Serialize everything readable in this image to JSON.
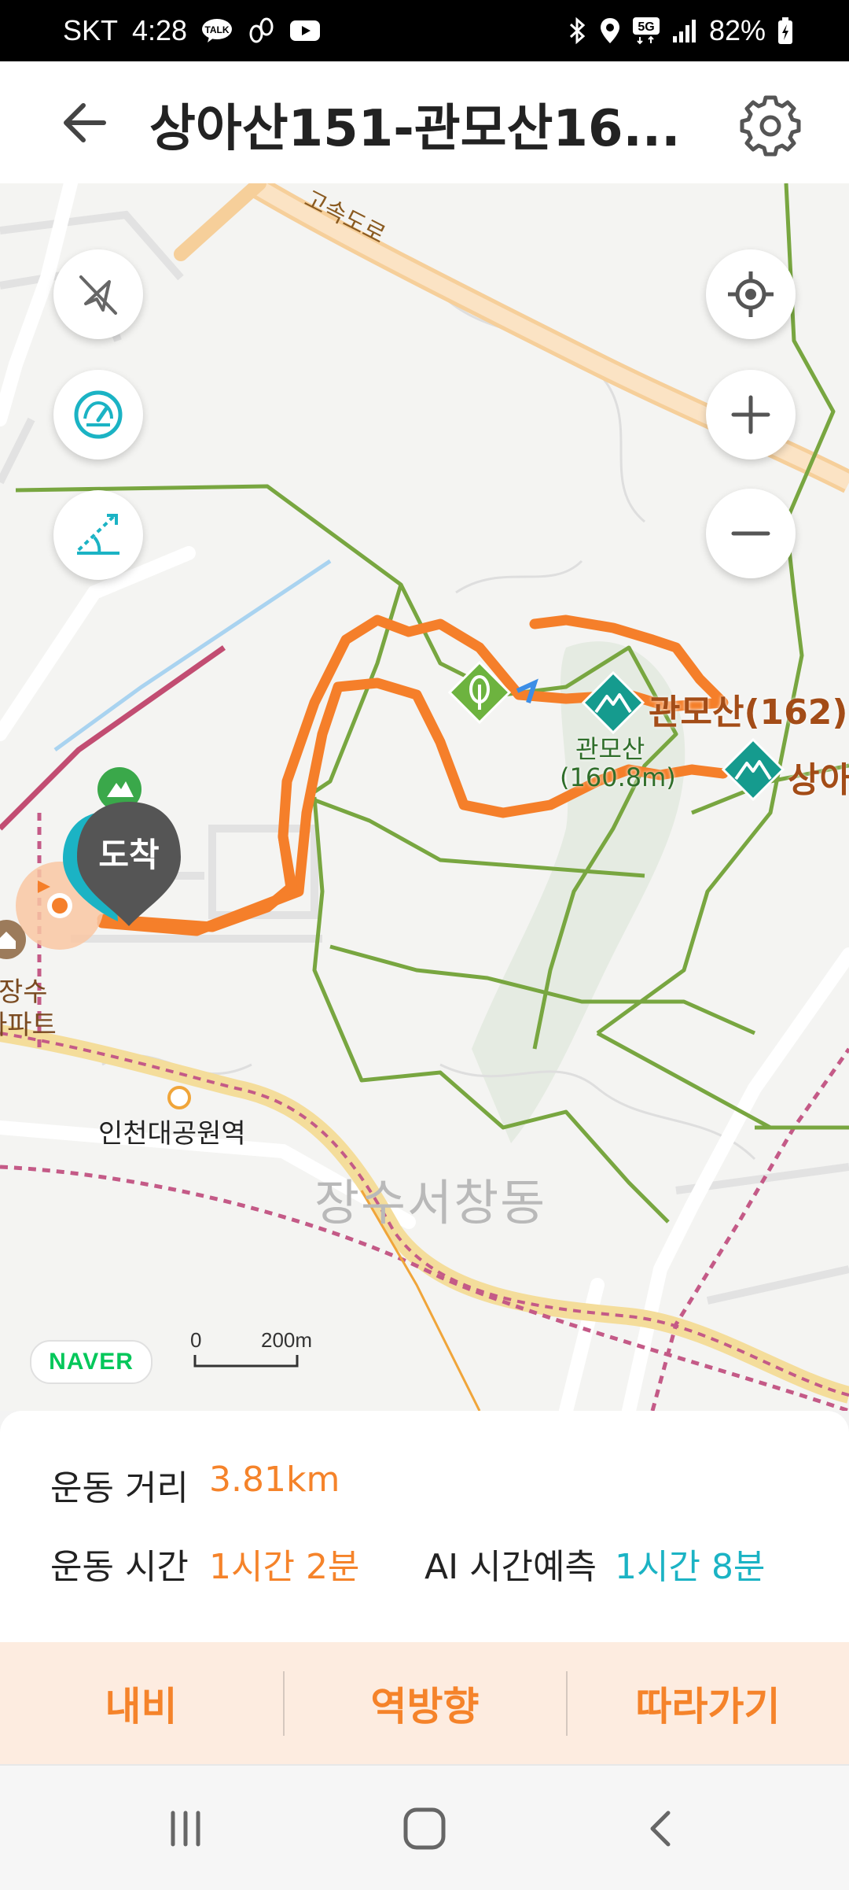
{
  "status_bar": {
    "carrier": "SKT",
    "time": "4:28",
    "talk_badge": "TALK",
    "network": "5G",
    "battery": "82%"
  },
  "header": {
    "title": "상아산151-관모산16..."
  },
  "map": {
    "labels": {
      "highway": "고속도로",
      "peak_main": "관모산(162)",
      "peak_sub_name": "관모산",
      "peak_sub_height": "(160.8m)",
      "peak_right": "상아",
      "arrival_marker": "도착",
      "apartment_line1": "장수",
      "apartment_line2": "아파트",
      "station": "인천대공원역",
      "district": "장수서창동"
    },
    "attribution": "NAVER",
    "scale": {
      "zero": "0",
      "distance": "200m"
    },
    "colors": {
      "route": "#f57f2a",
      "trail": "#78a640",
      "peak": "#159b8e"
    }
  },
  "info": {
    "distance_label": "운동 거리",
    "distance_value": "3.81km",
    "time_label": "운동 시간",
    "time_value": "1시간 2분",
    "ai_label": "AI 시간예측",
    "ai_value": "1시간 8분"
  },
  "actions": {
    "navigate": "내비",
    "reverse": "역방향",
    "follow": "따라가기"
  }
}
